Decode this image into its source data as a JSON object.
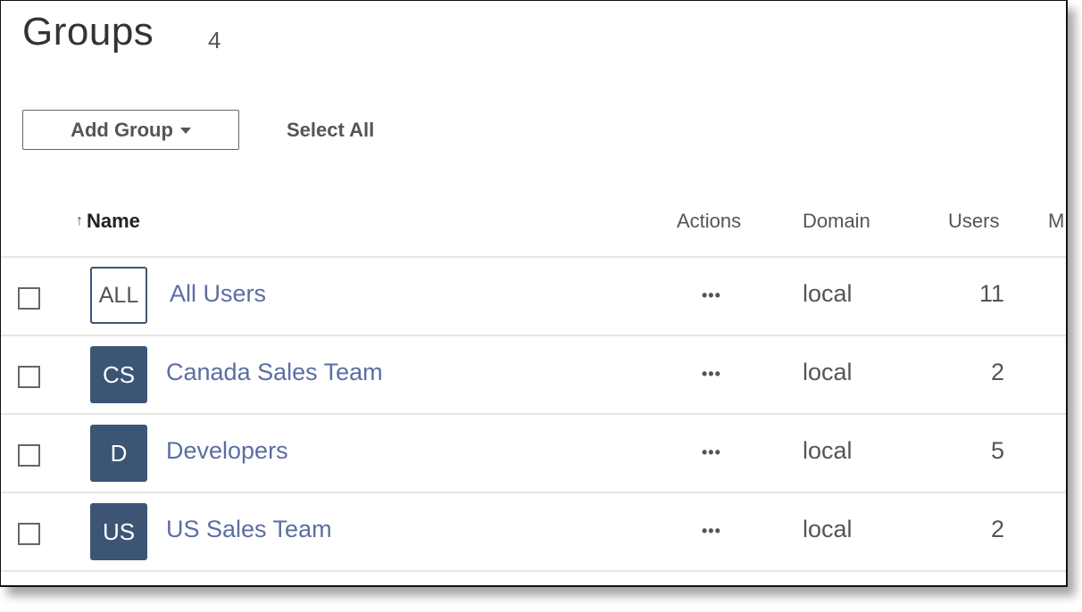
{
  "header": {
    "title": "Groups",
    "count": "4"
  },
  "toolbar": {
    "add_group_label": "Add Group",
    "select_all_label": "Select All"
  },
  "table": {
    "columns": {
      "name": "Name",
      "actions": "Actions",
      "domain": "Domain",
      "users": "Users",
      "more": "M"
    },
    "sort": {
      "column": "name",
      "direction": "ascending",
      "icon": "sort-up-arrow-icon",
      "glyph": "↑"
    },
    "actions_glyph": "•••",
    "rows": [
      {
        "initials": "ALL",
        "name": "All Users",
        "domain": "local",
        "users": "11",
        "avatar_style": "outline",
        "checked": false
      },
      {
        "initials": "CS",
        "name": "Canada Sales Team",
        "domain": "local",
        "users": "2",
        "avatar_style": "filled",
        "checked": false
      },
      {
        "initials": "D",
        "name": "Developers",
        "domain": "local",
        "users": "5",
        "avatar_style": "filled",
        "checked": false
      },
      {
        "initials": "US",
        "name": "US Sales Team",
        "domain": "local",
        "users": "2",
        "avatar_style": "filled",
        "checked": false
      }
    ]
  },
  "colors": {
    "avatar_fill": "#3d5575",
    "link": "#5b6ea3",
    "text": "#555555",
    "divider": "#e6e6e6"
  }
}
